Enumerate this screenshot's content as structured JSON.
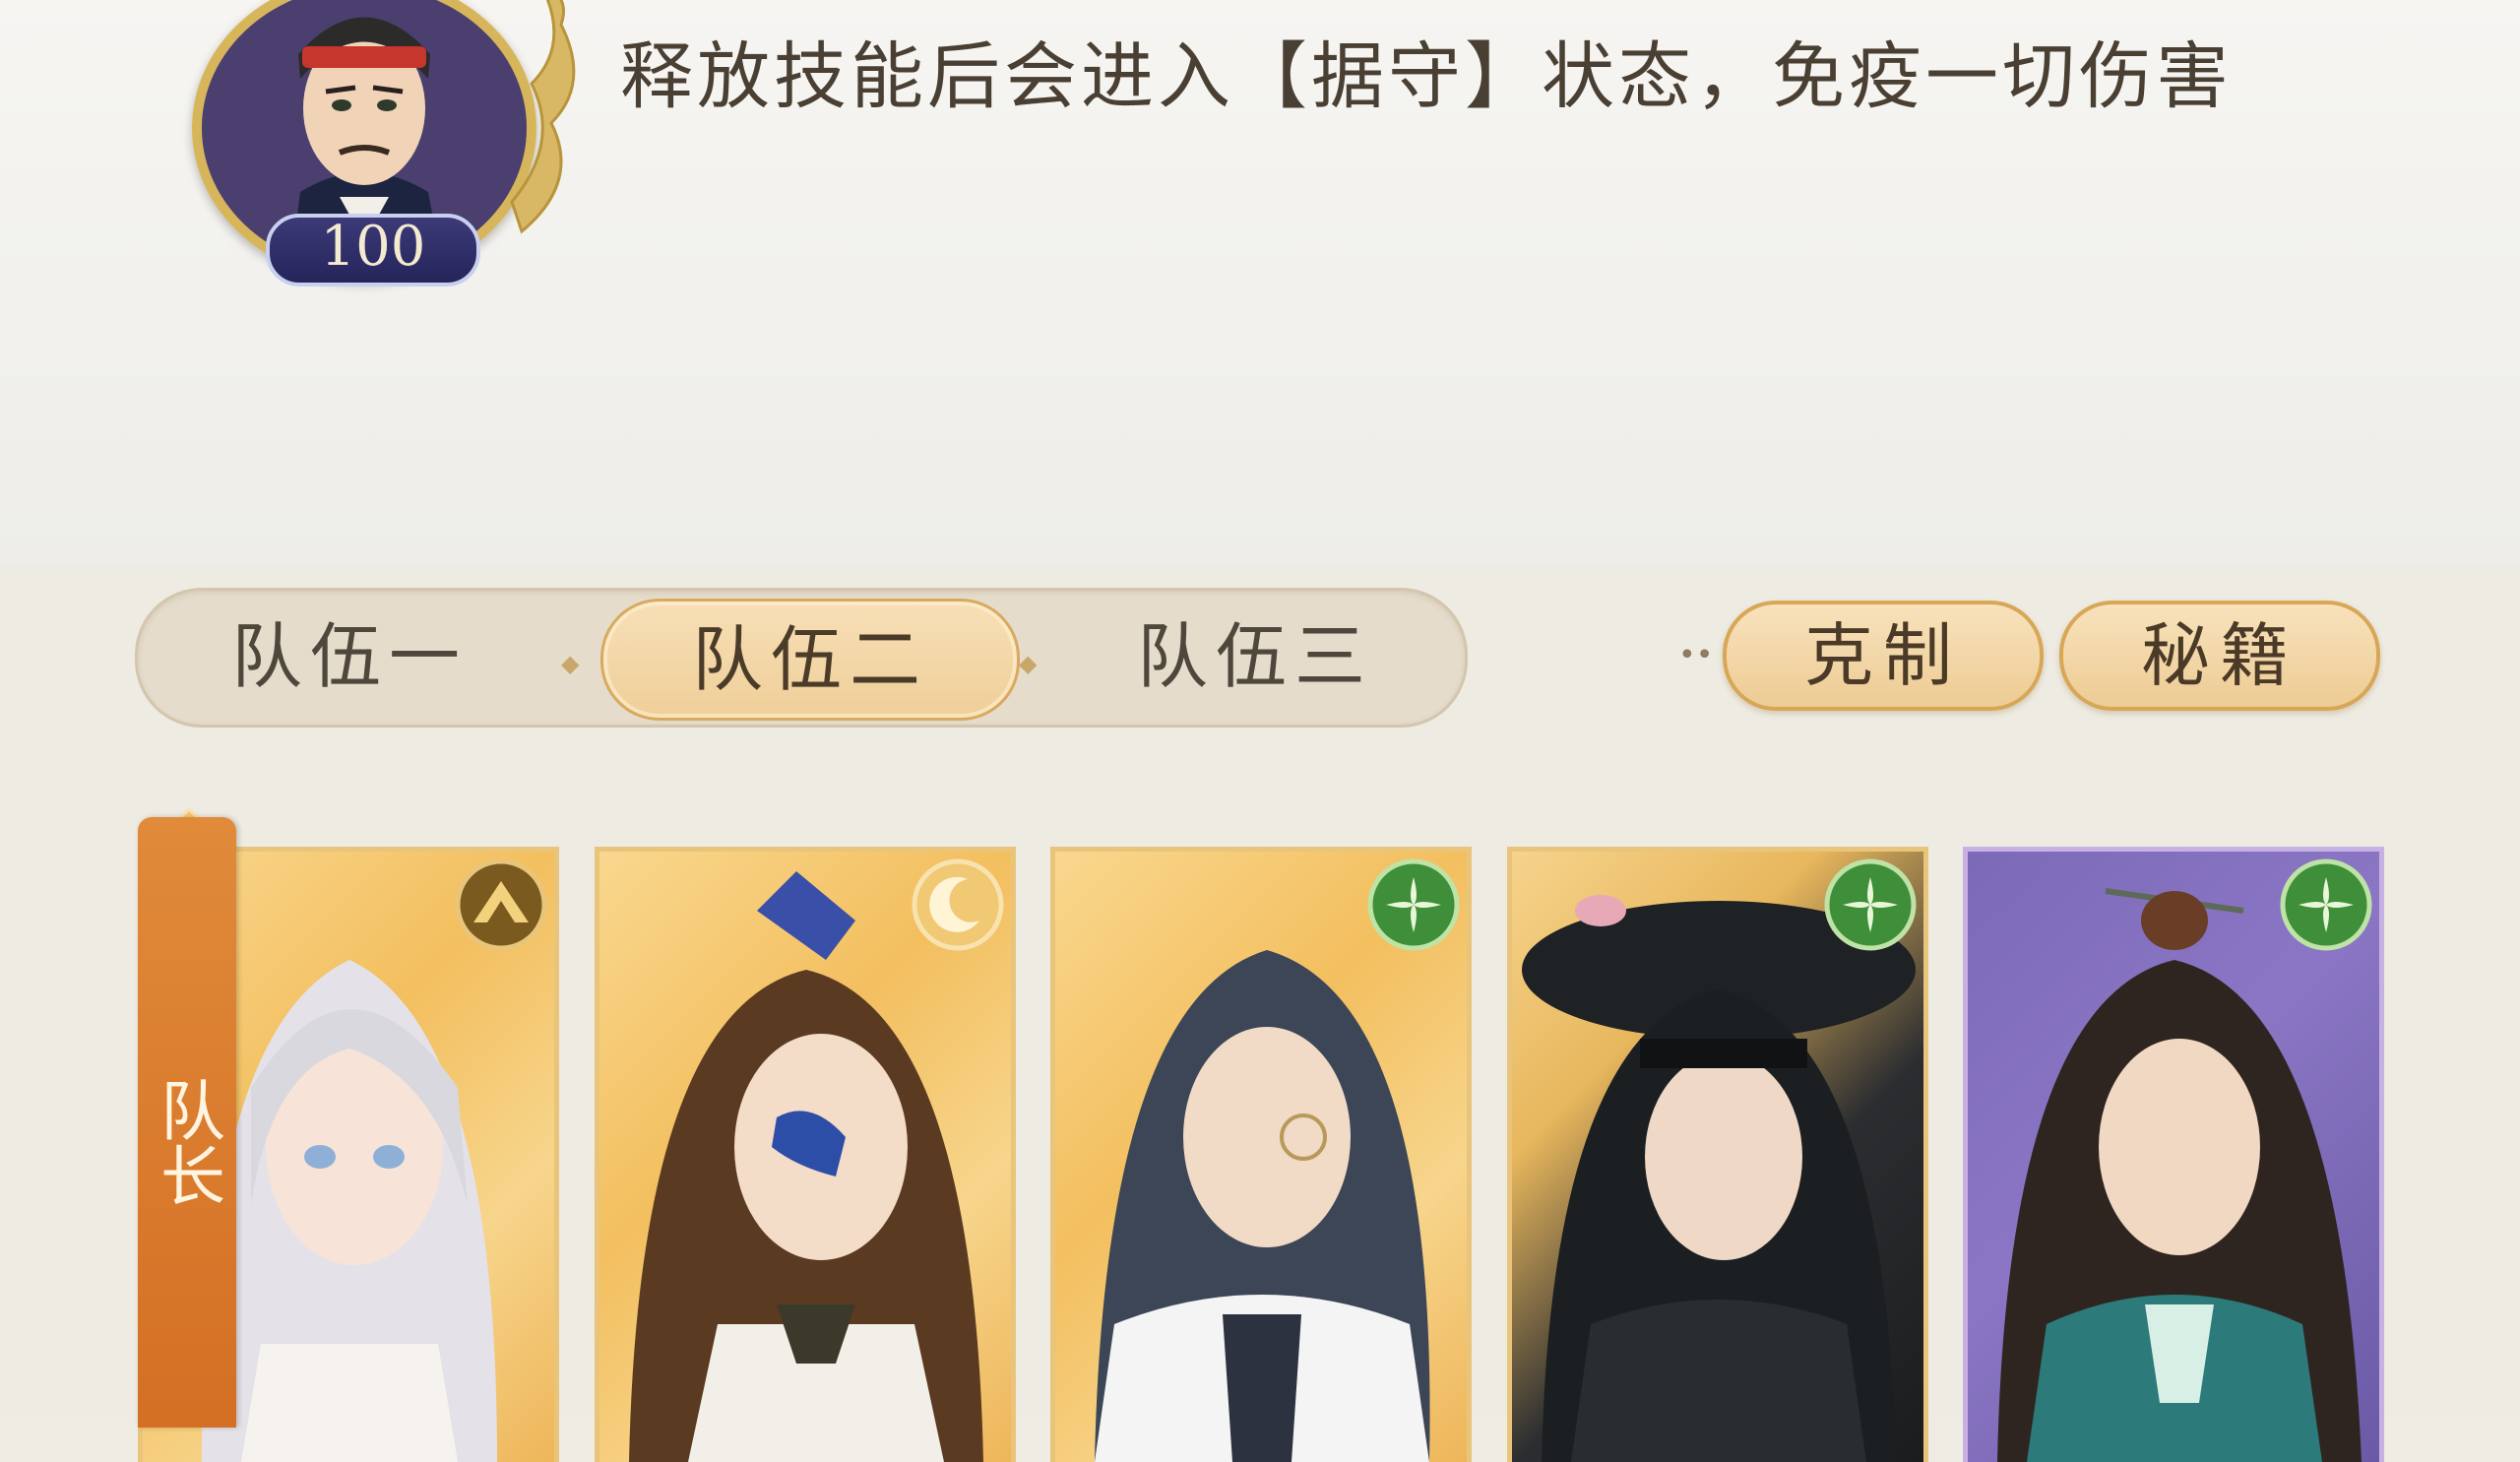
{
  "enemy": {
    "level": "100",
    "skill_description": "释放技能后会进入【据守】状态，免疫一切伤害"
  },
  "team_tabs": [
    {
      "label": "队伍一",
      "selected": false
    },
    {
      "label": "队伍二",
      "selected": true
    },
    {
      "label": "队伍三",
      "selected": false
    }
  ],
  "buttons": {
    "counter": "克制",
    "manual": "秘籍"
  },
  "cards": [
    {
      "name": "",
      "leader": true,
      "leader_label": "队长",
      "element_icon": "mountain-element-icon",
      "rarity_color": "gold"
    },
    {
      "name": "",
      "leader": false,
      "element_icon": "moon-element-icon",
      "rarity_color": "gold"
    },
    {
      "name": "",
      "leader": false,
      "element_icon": "wind-element-icon",
      "rarity_color": "gold"
    },
    {
      "name": "",
      "leader": false,
      "element_icon": "wind-element-icon",
      "rarity_color": "gold"
    },
    {
      "name": "",
      "leader": false,
      "element_icon": "wind-element-icon",
      "rarity_color": "purple"
    }
  ],
  "colors": {
    "tab_selected": "#efcf99",
    "button_fill": "#edcc94",
    "leader_ribbon": "#d46f24",
    "wind_badge": "#3f8f3a",
    "mountain_badge": "#7a5a1e"
  }
}
